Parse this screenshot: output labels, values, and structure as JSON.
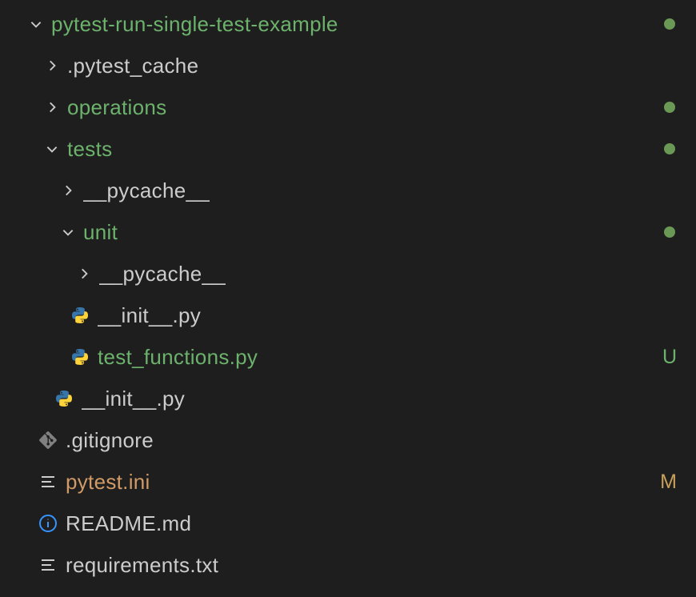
{
  "tree": {
    "root": {
      "label": "pytest-run-single-test-example"
    },
    "pytest_cache": {
      "label": ".pytest_cache"
    },
    "operations": {
      "label": "operations"
    },
    "tests": {
      "label": "tests"
    },
    "tests_pycache": {
      "label": "__pycache__"
    },
    "unit": {
      "label": "unit"
    },
    "unit_pycache": {
      "label": "__pycache__"
    },
    "unit_init": {
      "label": "__init__.py"
    },
    "test_functions": {
      "label": "test_functions.py",
      "status": "U"
    },
    "tests_init": {
      "label": "__init__.py"
    },
    "gitignore": {
      "label": ".gitignore"
    },
    "pytest_ini": {
      "label": "pytest.ini",
      "status": "M"
    },
    "readme": {
      "label": "README.md"
    },
    "requirements": {
      "label": "requirements.txt"
    }
  }
}
